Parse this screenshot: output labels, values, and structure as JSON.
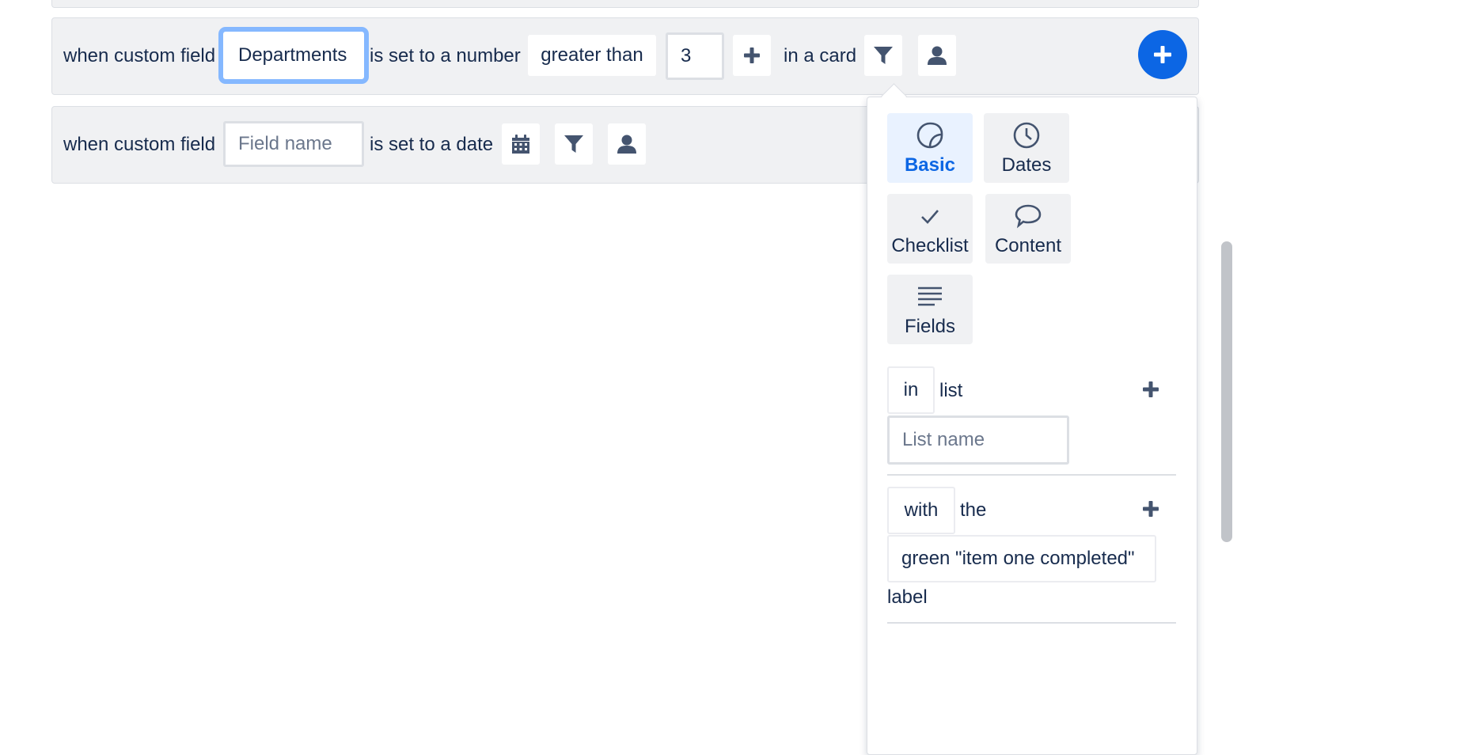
{
  "row1": {
    "prefix": "when custom field",
    "field_value": "Departments",
    "middle": "is set to a number",
    "comparator": "greater than",
    "number_value": "3",
    "suffix": "in a card"
  },
  "row2": {
    "prefix": "when custom field",
    "field_placeholder": "Field name",
    "middle": "is set to a date"
  },
  "icons": {
    "add": "plus-icon",
    "filter": "filter-icon",
    "user": "user-icon",
    "calendar": "calendar-icon",
    "add_circle": "add-circle-icon"
  },
  "popover": {
    "tabs": [
      {
        "label": "Basic",
        "icon": "sticker-icon",
        "active": true
      },
      {
        "label": "Dates",
        "icon": "clock-icon",
        "active": false
      },
      {
        "label": "Checklist",
        "icon": "check-icon",
        "active": false
      },
      {
        "label": "Content",
        "icon": "speech-bubble-icon",
        "active": false
      },
      {
        "label": "Fields",
        "icon": "lines-icon",
        "active": false
      }
    ],
    "filter1": {
      "chip": "in",
      "text": "list",
      "input_placeholder": "List name"
    },
    "filter2": {
      "chip": "with",
      "text": "the",
      "label_value": "green \"item one completed\"",
      "suffix": "label"
    }
  },
  "colors": {
    "accent": "#0c66e4",
    "focus_ring": "#85b8ff",
    "row_bg": "#f0f1f3",
    "active_tab_bg": "#e9f2ff",
    "text": "#172b4d"
  }
}
